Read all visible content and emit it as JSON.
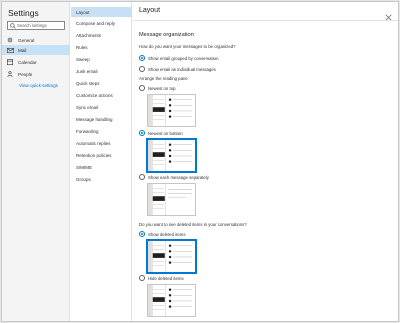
{
  "settings": {
    "title": "Settings",
    "search_placeholder": "Search settings",
    "nav_items": [
      {
        "label": "General",
        "icon": "gear-icon"
      },
      {
        "label": "Mail",
        "icon": "mail-icon",
        "selected": true
      },
      {
        "label": "Calendar",
        "icon": "calendar-icon"
      },
      {
        "label": "People",
        "icon": "people-icon"
      }
    ],
    "quick_settings_link": "View quick settings"
  },
  "mail_menu": {
    "items": [
      "Layout",
      "Compose and reply",
      "Attachments",
      "Rules",
      "Sweep",
      "Junk email",
      "Quick steps",
      "Customize actions",
      "Sync email",
      "Message handling",
      "Forwarding",
      "Automatic replies",
      "Retention policies",
      "S/MIME",
      "Groups"
    ],
    "selected": "Layout"
  },
  "layout_panel": {
    "title": "Layout",
    "section_title": "Message organization",
    "organize_question": "How do you want your messages to be organized?",
    "organize_options": [
      "Show email grouped by conversation",
      "Show email as individual messages"
    ],
    "reading_pane_label": "Arrange the reading pane",
    "reading_pane_options": [
      "Newest on top",
      "Newest on bottom",
      "Show each message separately"
    ],
    "deleted_question": "Do you want to see deleted items in your conversations?",
    "deleted_options": [
      "Show deleted items",
      "Hide deleted items"
    ]
  },
  "colors": {
    "accent": "#0078d4",
    "selection": "#c7e0f4"
  }
}
